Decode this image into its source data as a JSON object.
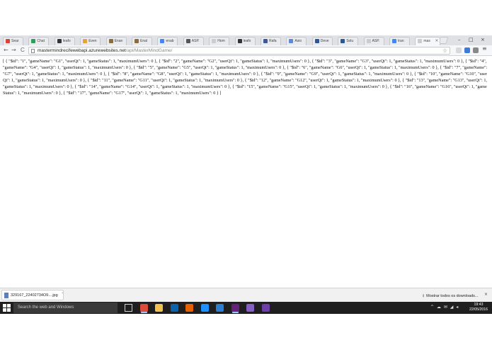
{
  "browser": {
    "tabs": [
      {
        "label": "Sear",
        "color": "#d44638"
      },
      {
        "label": "Chat",
        "color": "#2e9e5b"
      },
      {
        "label": "leafo",
        "color": "#333333"
      },
      {
        "label": "Even",
        "color": "#e6a23c"
      },
      {
        "label": "Enan",
        "color": "#8a6d3b"
      },
      {
        "label": "Enal",
        "color": "#8a6d3b"
      },
      {
        "label": "enab",
        "color": "#4285f4"
      },
      {
        "label": "ASP.",
        "color": "#555555"
      },
      {
        "label": "Hom",
        "color": "#cccccc"
      },
      {
        "label": "leafo",
        "color": "#333333"
      },
      {
        "label": "Rafa",
        "color": "#3b5998"
      },
      {
        "label": "Asio",
        "color": "#5d8ad8"
      },
      {
        "label": "Deve",
        "color": "#2b5797"
      },
      {
        "label": "Solu",
        "color": "#2b5797"
      },
      {
        "label": "ASP.",
        "color": "#cccccc"
      },
      {
        "label": "tran",
        "color": "#4285f4"
      },
      {
        "label": "mas",
        "color": "#cccccc"
      }
    ],
    "url_host": "mastermindrecifewebapi.azurewebsites.net",
    "url_path": "/api/MasterMindGame/",
    "back_icon": "←",
    "forward_icon": "→",
    "reload_icon": "C",
    "star_icon": "☆",
    "close_glyph": "×",
    "minimize_glyph": "–",
    "maximize_glyph": "□"
  },
  "content": {
    "json_text": "[ { \"$id\": \"1\", \"gameName\": \"G1\", \"userQt\": 1, \"gameStatus\": 1, \"maximumUsers\": 0 }, { \"$id\": \"2\", \"gameName\": \"G2\", \"userQt\": 1, \"gameStatus\": 1, \"maximumUsers\": 0 }, { \"$id\": \"3\", \"gameName\": \"G3\", \"userQt\": 1, \"gameStatus\": 1, \"maximumUsers\": 0 }, { \"$id\": \"4\", \"gameName\": \"G4\", \"userQt\": 1, \"gameStatus\": 1, \"maximumUsers\": 0 }, { \"$id\": \"5\", \"gameName\": \"G5\", \"userQt\": 1, \"gameStatus\": 1, \"maximumUsers\": 0 }, { \"$id\": \"6\", \"gameName\": \"G6\", \"userQt\": 1, \"gameStatus\": 1, \"maximumUsers\": 0 }, { \"$id\": \"7\", \"gameName\": \"G7\", \"userQt\": 1, \"gameStatus\": 1, \"maximumUsers\": 0 }, { \"$id\": \"8\", \"gameName\": \"G8\", \"userQt\": 1, \"gameStatus\": 1, \"maximumUsers\": 0 }, { \"$id\": \"9\", \"gameName\": \"G9\", \"userQt\": 1, \"gameStatus\": 1, \"maximumUsers\": 0 }, { \"$id\": \"10\", \"gameName\": \"G10\", \"userQt\": 1, \"gameStatus\": 1, \"maximumUsers\": 0 }, { \"$id\": \"11\", \"gameName\": \"G11\", \"userQt\": 1, \"gameStatus\": 1, \"maximumUsers\": 0 }, { \"$id\": \"12\", \"gameName\": \"G12\", \"userQt\": 1, \"gameStatus\": 1, \"maximumUsers\": 0 }, { \"$id\": \"13\", \"gameName\": \"G13\", \"userQt\": 1, \"gameStatus\": 1, \"maximumUsers\": 0 }, { \"$id\": \"14\", \"gameName\": \"G14\", \"userQt\": 1, \"gameStatus\": 1, \"maximumUsers\": 0 }, { \"$id\": \"15\", \"gameName\": \"G15\", \"userQt\": 1, \"gameStatus\": 1, \"maximumUsers\": 0 }, { \"$id\": \"16\", \"gameName\": \"G16\", \"userQt\": 1, \"gameStatus\": 1, \"maximumUsers\": 0 }, { \"$id\": \"17\", \"gameName\": \"G17\", \"userQt\": 1, \"gameStatus\": 1, \"maximumUsers\": 0 } ]"
  },
  "downloads": {
    "file_name": "329167_22402734O9....jpg",
    "chevron_glyph": "˅",
    "show_all_label": "Mostrar todos os downloads...",
    "download_icon": "⭳",
    "close_glyph": "×"
  },
  "taskbar": {
    "search_placeholder": "Search the web and Windows",
    "pinned": [
      {
        "name": "task-view-icon",
        "color": "#1f1f1f",
        "running": false
      },
      {
        "name": "chrome-icon",
        "color": "#dd4b39",
        "running": true
      },
      {
        "name": "file-explorer-icon",
        "color": "#f2c14e",
        "running": false
      },
      {
        "name": "outlook-icon",
        "color": "#0a64ad",
        "running": false
      },
      {
        "name": "firefox-icon",
        "color": "#e66000",
        "running": false
      },
      {
        "name": "edge-icon",
        "color": "#1e90ff",
        "running": false
      },
      {
        "name": "store-icon",
        "color": "#2d7dd2",
        "running": false
      },
      {
        "name": "visual-studio-icon",
        "color": "#68217a",
        "running": true
      },
      {
        "name": "visual-studio-2-icon",
        "color": "#865fc5",
        "running": false
      },
      {
        "name": "app-icon",
        "color": "#6e3fa8",
        "running": false
      }
    ],
    "tray_glyphs": "^ ☁ ✉ ◢ ◂",
    "time": "19:43",
    "date": "22/05/2016"
  }
}
